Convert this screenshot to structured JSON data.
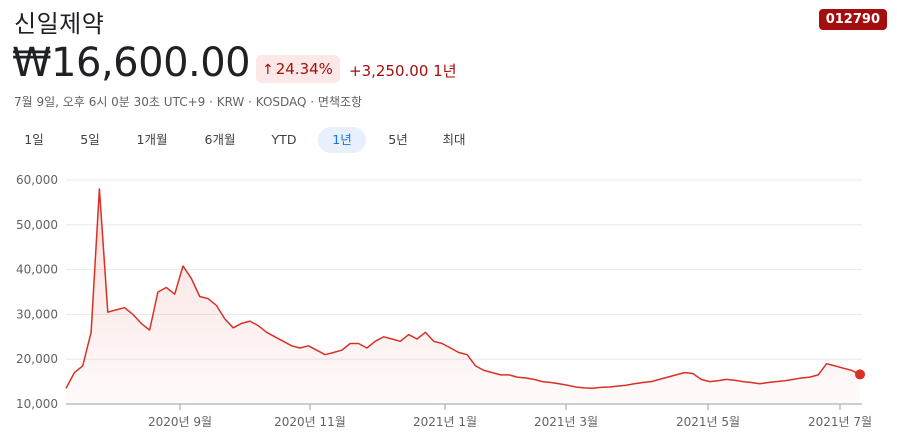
{
  "stock": {
    "name": "신일제약",
    "ticker": "012790",
    "price": "₩16,600.00",
    "change_arrow": "↑",
    "change_percent": "24.34%",
    "change_absolute": "+3,250.00",
    "change_period": "1년",
    "meta": "7월 9일, 오후 6시 0분 30초 UTC+9 · KRW · KOSDAQ · 면책조항"
  },
  "colors": {
    "accent_red": "#d93025",
    "ticker_bg": "#a50e0e",
    "tab_active_bg": "#e8f0fe",
    "tab_active_text": "#1a73e8"
  },
  "range_tabs": [
    {
      "label": "1일",
      "active": false
    },
    {
      "label": "5일",
      "active": false
    },
    {
      "label": "1개월",
      "active": false
    },
    {
      "label": "6개월",
      "active": false
    },
    {
      "label": "YTD",
      "active": false
    },
    {
      "label": "1년",
      "active": true
    },
    {
      "label": "5년",
      "active": false
    },
    {
      "label": "최대",
      "active": false
    }
  ],
  "chart_data": {
    "type": "area",
    "title": "",
    "xlabel": "",
    "ylabel": "",
    "ylim": [
      10000,
      60000
    ],
    "y_ticks": [
      "60,000",
      "50,000",
      "40,000",
      "30,000",
      "20,000",
      "10,000"
    ],
    "x_ticks": [
      "2020년 9월",
      "2020년 11월",
      "2021년 1월",
      "2021년 3월",
      "2021년 5월",
      "2021년 7월"
    ],
    "grid": true,
    "series": [
      {
        "x_index_range": [
          0,
          100
        ],
        "values": [
          13500,
          17000,
          18500,
          26000,
          58000,
          30500,
          31000,
          31500,
          30000,
          28000,
          26500,
          35000,
          36000,
          34500,
          40800,
          38000,
          34000,
          33500,
          32000,
          29000,
          27000,
          28000,
          28500,
          27500,
          26000,
          25000,
          24000,
          23000,
          22500,
          23000,
          22000,
          21000,
          21500,
          22000,
          23500,
          23500,
          22500,
          24000,
          25000,
          24500,
          24000,
          25500,
          24500,
          26000,
          24000,
          23500,
          22500,
          21500,
          21000,
          18500,
          17500,
          17000,
          16500,
          16500,
          16000,
          15800,
          15500,
          15000,
          14800,
          14500,
          14200,
          13800,
          13600,
          13500,
          13700,
          13800,
          14000,
          14200,
          14500,
          14800,
          15000,
          15500,
          16000,
          16500,
          17000,
          16800,
          15500,
          15000,
          15200,
          15500,
          15300,
          15000,
          14800,
          14500,
          14800,
          15000,
          15200,
          15500,
          15800,
          16000,
          16500,
          19000,
          18500,
          18000,
          17500,
          16600
        ],
        "last_value": 16600
      }
    ]
  }
}
